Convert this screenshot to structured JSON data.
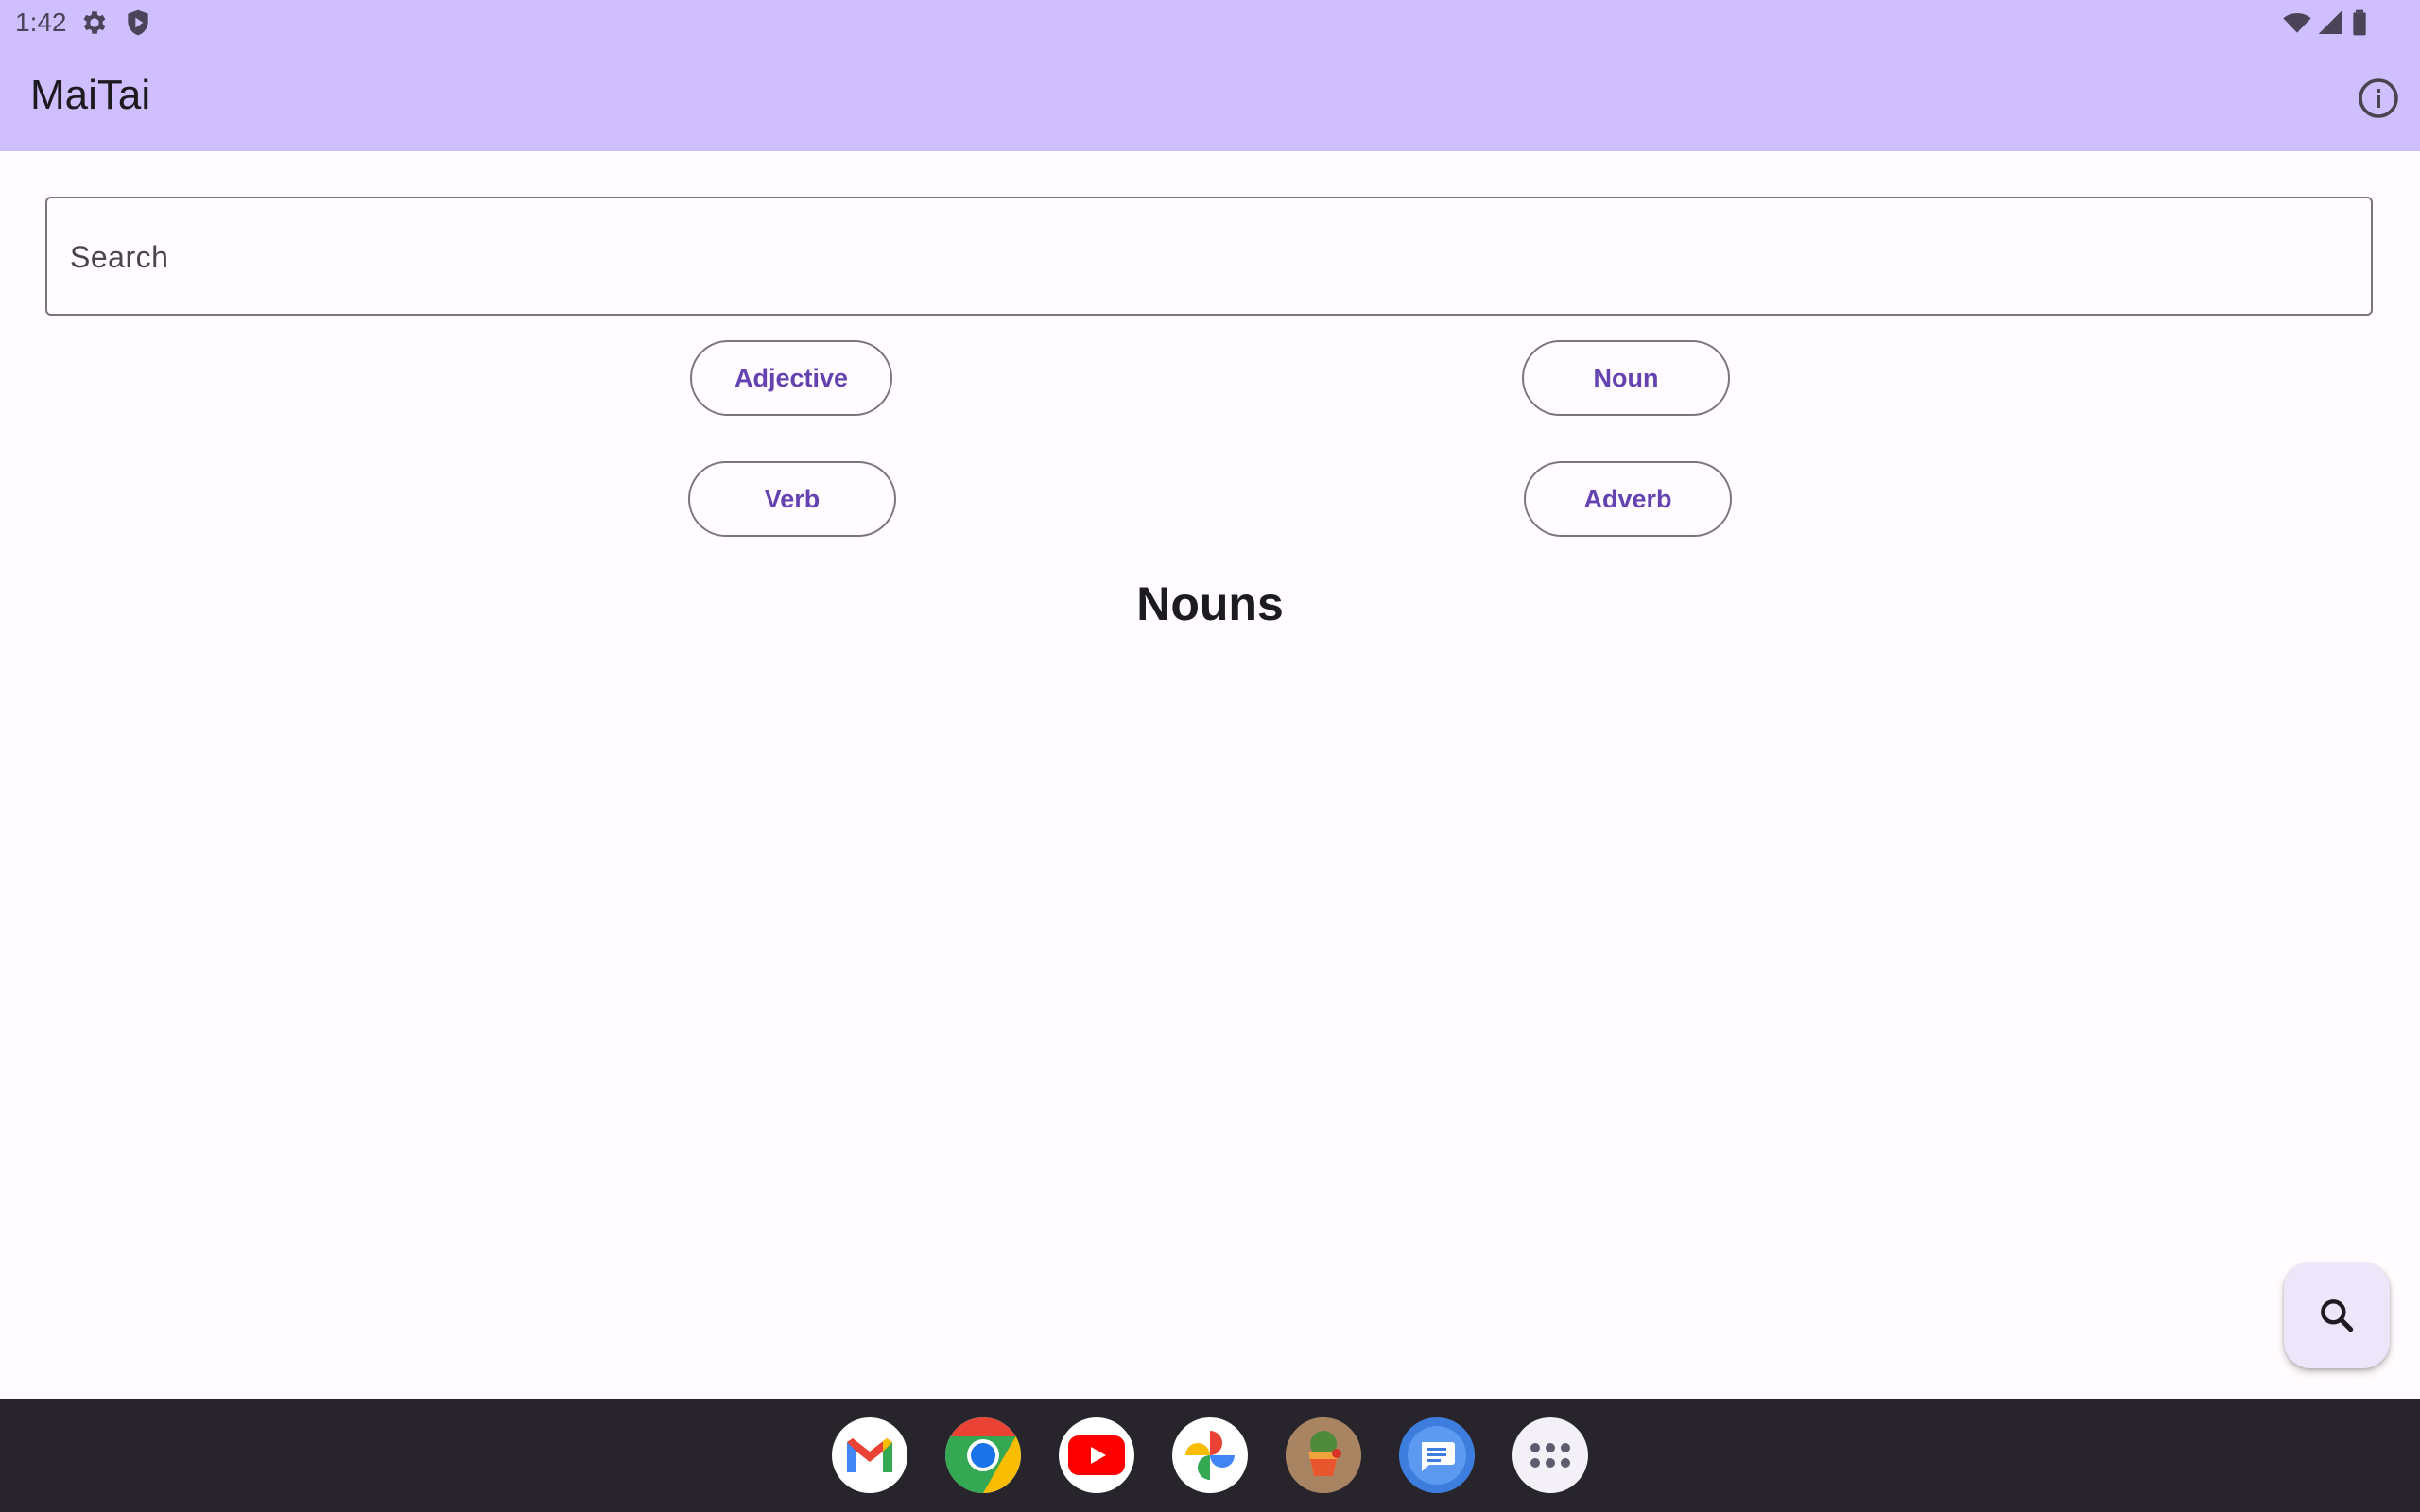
{
  "status_bar": {
    "time": "1:42",
    "icons": [
      "gear-icon",
      "play-protect-icon",
      "wifi-icon",
      "cell-signal-icon",
      "battery-icon"
    ]
  },
  "app_bar": {
    "title": "MaiTai",
    "info_icon": "info-icon"
  },
  "search": {
    "placeholder": "Search",
    "value": ""
  },
  "filters": {
    "adjective": "Adjective",
    "noun": "Noun",
    "verb": "Verb",
    "adverb": "Adverb"
  },
  "section": {
    "heading": "Nouns"
  },
  "fab": {
    "icon": "search-icon"
  },
  "dock": {
    "apps": [
      "gmail",
      "chrome",
      "youtube",
      "photos",
      "maitai",
      "messages",
      "app-drawer"
    ]
  },
  "colors": {
    "app_bar": "#CFBFFF",
    "accent_text": "#6442B0",
    "background": "#FFFBFE",
    "taskbar": "#27252B",
    "fab": "#EDE6FB"
  }
}
